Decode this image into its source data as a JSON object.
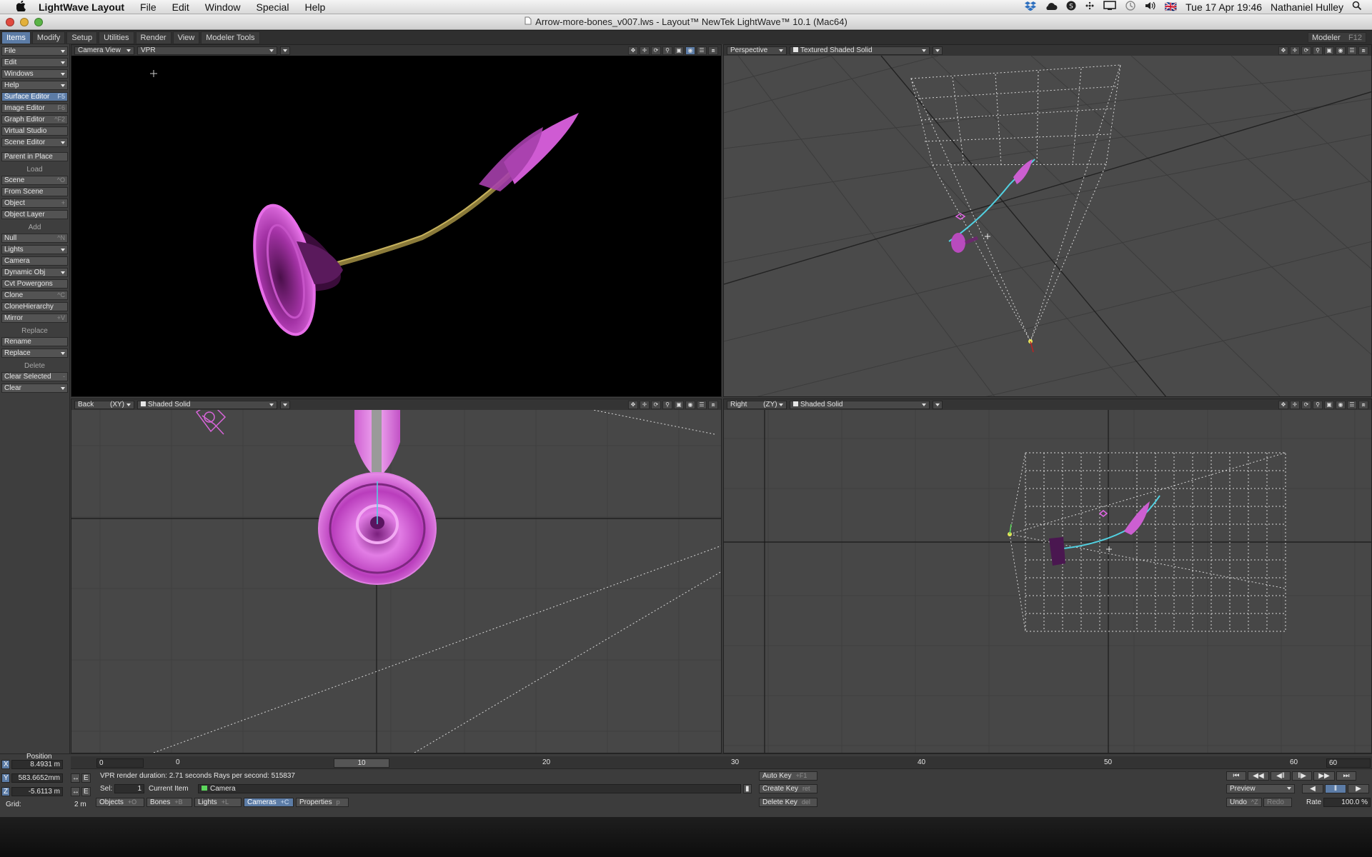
{
  "menubar": {
    "app_name": "LightWave Layout",
    "items": [
      "File",
      "Edit",
      "Window",
      "Special",
      "Help"
    ],
    "flag": "🇬🇧",
    "datetime": "Tue 17 Apr  19:46",
    "user": "Nathaniel Hulley"
  },
  "window": {
    "title": "Arrow-more-bones_v007.lws - Layout™ NewTek LightWave™ 10.1 (Mac64)"
  },
  "tabs": {
    "items": [
      "Items",
      "Modify",
      "Setup",
      "Utilities",
      "Render",
      "View",
      "Modeler Tools"
    ],
    "active": "Items",
    "modeler_label": "Modeler",
    "modeler_key": "F12"
  },
  "toolbar": {
    "file": "File",
    "edit": "Edit",
    "windows": "Windows",
    "help": "Help",
    "surface_editor": "Surface Editor",
    "surface_editor_key": "F5",
    "image_editor": "Image Editor",
    "image_editor_key": "F6",
    "graph_editor": "Graph Editor",
    "graph_editor_key": "^F2",
    "virtual_studio": "Virtual Studio",
    "scene_editor": "Scene Editor",
    "parent_in_place": "Parent in Place",
    "load_header": "Load",
    "scene": "Scene",
    "scene_key": "^O",
    "from_scene": "From Scene",
    "object": "Object",
    "object_key": "+",
    "object_layer": "Object Layer",
    "add_header": "Add",
    "null": "Null",
    "null_key": "^N",
    "lights": "Lights",
    "camera": "Camera",
    "dynamic_obj": "Dynamic Obj",
    "cvt_powergons": "Cvt Powergons",
    "clone": "Clone",
    "clone_key": "^C",
    "clone_hierarchy": "CloneHierarchy",
    "mirror": "Mirror",
    "mirror_key": "+V",
    "replace_header": "Replace",
    "rename": "Rename",
    "replace": "Replace",
    "delete_header": "Delete",
    "clear_selected": "Clear Selected",
    "clear_selected_key": "-",
    "clear": "Clear"
  },
  "viewports": {
    "top_left": {
      "view": "Camera View",
      "mode": "VPR"
    },
    "top_right": {
      "view": "Perspective",
      "mode": "Textured Shaded Solid"
    },
    "bottom_left": {
      "view": "Back",
      "axis": "(XY)",
      "mode": "Shaded Solid"
    },
    "bottom_right": {
      "view": "Right",
      "axis": "(ZY)",
      "mode": "Shaded Solid"
    }
  },
  "bottom": {
    "position_label": "Position",
    "x_label": "X",
    "x_value": "8.4931 m",
    "y_label": "Y",
    "y_value": "583.6652mm",
    "z_label": "Z",
    "z_value": "-5.6113 m",
    "e_label": "E",
    "grid_label": "Grid:",
    "grid_value": "2 m",
    "frame_field": "0",
    "timeline_ticks": [
      "0",
      "10",
      "20",
      "30",
      "40",
      "50",
      "60"
    ],
    "timeline_end": "60",
    "current_frame": "10",
    "render_status": "VPR render duration: 2.71 seconds   Rays per second: 515837",
    "sel_label": "Sel:",
    "sel_value": "1",
    "current_item_label": "Current Item",
    "current_item": "Camera",
    "filters": [
      {
        "label": "Objects",
        "key": "+O"
      },
      {
        "label": "Bones",
        "key": "+B"
      },
      {
        "label": "Lights",
        "key": "+L"
      },
      {
        "label": "Cameras",
        "key": "+C"
      },
      {
        "label": "Properties",
        "key": "p"
      }
    ],
    "auto_key": "Auto Key",
    "auto_key_key": "+F1",
    "create_key": "Create Key",
    "create_key_key": "ret",
    "delete_key": "Delete Key",
    "delete_key_key": "del",
    "preview": "Preview",
    "undo": "Undo",
    "undo_key": "^Z",
    "redo": "Redo",
    "rate_label": "Rate",
    "rate_value": "100.0 %"
  },
  "colors": {
    "accent": "#5c7ca6",
    "magenta": "#d455d6",
    "grid_bg": "#474747"
  }
}
